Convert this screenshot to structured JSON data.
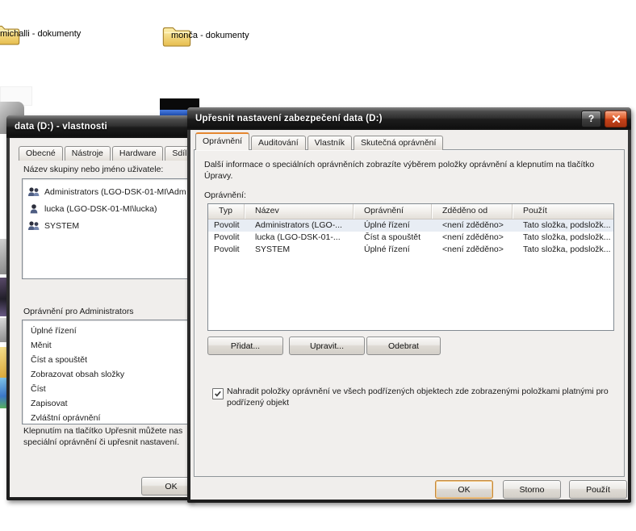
{
  "desktop": {
    "icons": [
      {
        "label": "michalli - dokumenty"
      },
      {
        "label": "monča - dokumenty"
      }
    ]
  },
  "properties_dialog": {
    "title": "data (D:) - vlastnosti",
    "tabs": [
      "Obecné",
      "Nástroje",
      "Hardware",
      "Sdílení"
    ],
    "group_label": "Název skupiny nebo jméno uživatele:",
    "users": [
      {
        "name": "Administrators (LGO-DSK-01-MI\\Adm",
        "type": "group"
      },
      {
        "name": "lucka (LGO-DSK-01-MI\\lucka)",
        "type": "user"
      },
      {
        "name": "SYSTEM",
        "type": "group"
      }
    ],
    "permissions_label": "Oprávnění pro Administrators",
    "permissions": [
      "Úplné řízení",
      "Měnit",
      "Číst a spouštět",
      "Zobrazovat obsah složky",
      "Číst",
      "Zapisovat",
      "Zvláštní oprávnění"
    ],
    "hint_line1": "Klepnutím na tlačítko Upřesnit můžete nas",
    "hint_line2": "speciální oprávnění či upřesnit nastavení.",
    "ok_button": "OK"
  },
  "advanced_dialog": {
    "title": "Upřesnit nastavení zabezpečení data (D:)",
    "help_button": "?",
    "tabs": [
      "Oprávnění",
      "Auditování",
      "Vlastník",
      "Skutečná oprávnění"
    ],
    "active_tab": "Oprávnění",
    "description": "Další informace o speciálních oprávněních zobrazíte výběrem položky oprávnění a klepnutím na tlačítko Úpravy.",
    "list_label": "Oprávnění:",
    "table": {
      "columns": [
        "Typ",
        "Název",
        "Oprávnění",
        "Zděděno od",
        "Použít"
      ],
      "rows": [
        {
          "typ": "Povolit",
          "nazev": "Administrators (LGO-...",
          "opravneni": "Úplné řízení",
          "zdedeno": "<není zděděno>",
          "pouzit": "Tato složka, podsložk...",
          "selected": true
        },
        {
          "typ": "Povolit",
          "nazev": "lucka (LGO-DSK-01-...",
          "opravneni": "Číst a spouštět",
          "zdedeno": "<není zděděno>",
          "pouzit": "Tato složka, podsložk...",
          "selected": false
        },
        {
          "typ": "Povolit",
          "nazev": "SYSTEM",
          "opravneni": "Úplné řízení",
          "zdedeno": "<není zděděno>",
          "pouzit": "Tato složka, podsložk...",
          "selected": false
        }
      ]
    },
    "add_button": "Přidat...",
    "edit_button": "Upravit...",
    "remove_button": "Odebrat",
    "replace_checkbox": {
      "checked": true,
      "label": "Nahradit položky oprávnění ve všech podřízených objektech zde zobrazenými položkami platnými pro podřízený objekt"
    },
    "ok_button": "OK",
    "cancel_button": "Storno",
    "apply_button": "Použít"
  },
  "colors": {
    "accent_orange": "#e5872f",
    "titlebar_dark": "#2b2b2b",
    "close_red": "#c8431a",
    "row_selection": "#e8edf4"
  }
}
